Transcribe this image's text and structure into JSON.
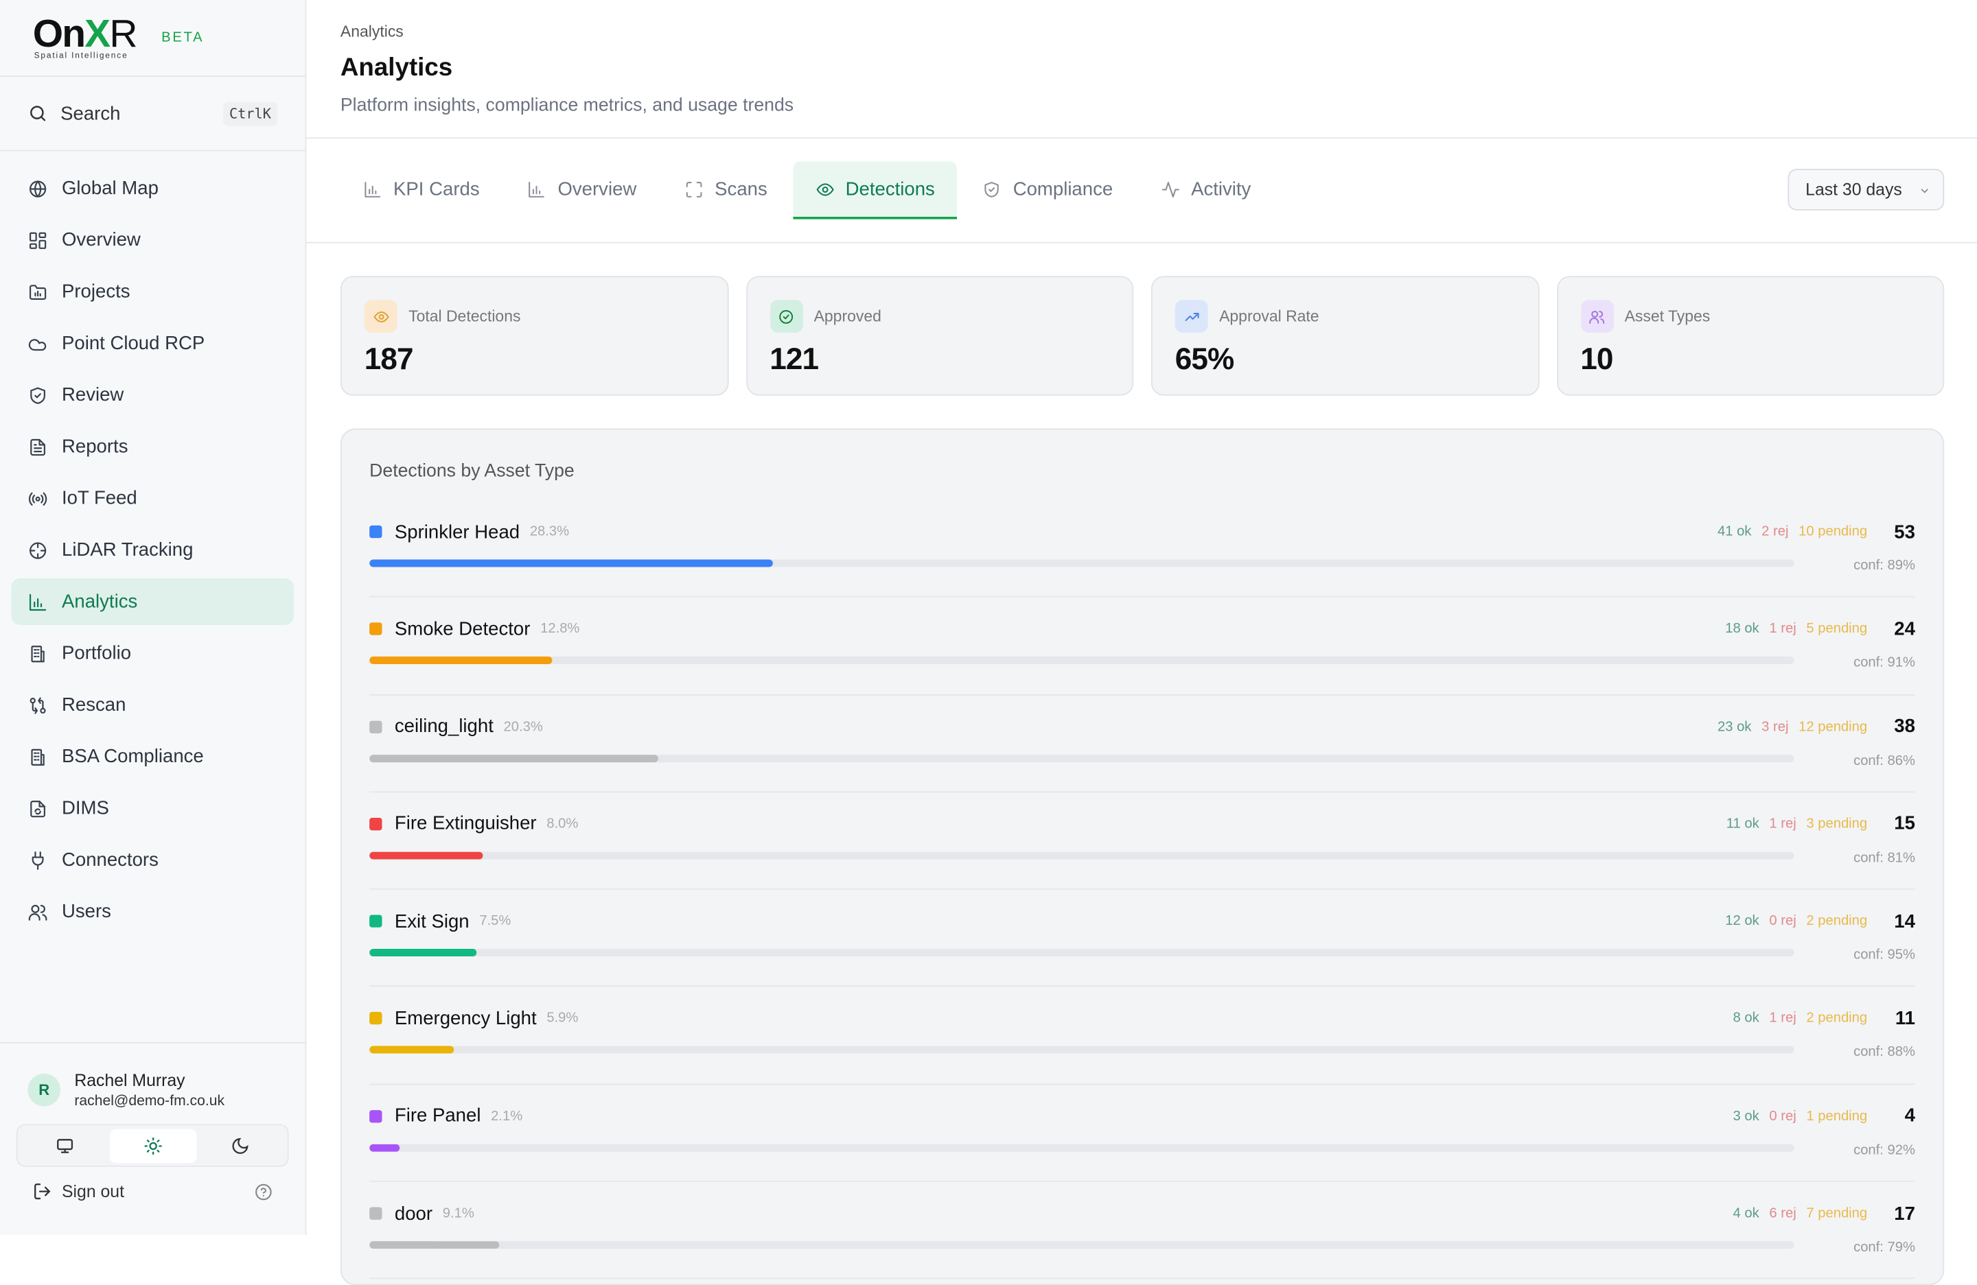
{
  "brand": {
    "logo_main": "On",
    "logo_x": "X",
    "logo_r": "R",
    "logo_sub": "Spatial Intelligence",
    "beta": "BETA"
  },
  "search": {
    "label": "Search",
    "shortcut": "CtrlK"
  },
  "sidebar": {
    "items": [
      {
        "label": "Global Map",
        "icon": "globe-icon",
        "name": "sidebar-item-global-map",
        "active": false
      },
      {
        "label": "Overview",
        "icon": "dashboard-icon",
        "name": "sidebar-item-overview",
        "active": false
      },
      {
        "label": "Projects",
        "icon": "folder-chart-icon",
        "name": "sidebar-item-projects",
        "active": false
      },
      {
        "label": "Point Cloud RCP",
        "icon": "cloud-icon",
        "name": "sidebar-item-point-cloud",
        "active": false
      },
      {
        "label": "Review",
        "icon": "shield-check-icon",
        "name": "sidebar-item-review",
        "active": false
      },
      {
        "label": "Reports",
        "icon": "file-text-icon",
        "name": "sidebar-item-reports",
        "active": false
      },
      {
        "label": "IoT Feed",
        "icon": "radio-icon",
        "name": "sidebar-item-iot-feed",
        "active": false
      },
      {
        "label": "LiDAR Tracking",
        "icon": "crosshair-icon",
        "name": "sidebar-item-lidar",
        "active": false
      },
      {
        "label": "Analytics",
        "icon": "bar-chart-icon",
        "name": "sidebar-item-analytics",
        "active": true
      },
      {
        "label": "Portfolio",
        "icon": "building-icon",
        "name": "sidebar-item-portfolio",
        "active": false
      },
      {
        "label": "Rescan",
        "icon": "git-compare-icon",
        "name": "sidebar-item-rescan",
        "active": false
      },
      {
        "label": "BSA Compliance",
        "icon": "building-icon",
        "name": "sidebar-item-bsa",
        "active": false
      },
      {
        "label": "DIMS",
        "icon": "file-sync-icon",
        "name": "sidebar-item-dims",
        "active": false
      },
      {
        "label": "Connectors",
        "icon": "plug-icon",
        "name": "sidebar-item-connectors",
        "active": false
      },
      {
        "label": "Users",
        "icon": "users-icon",
        "name": "sidebar-item-users",
        "active": false
      }
    ]
  },
  "user": {
    "initial": "R",
    "name": "Rachel Murray",
    "email": "rachel@demo-fm.co.uk"
  },
  "theme": {
    "selected": "light"
  },
  "signout": {
    "label": "Sign out"
  },
  "header": {
    "breadcrumb": "Analytics",
    "title": "Analytics",
    "subtitle": "Platform insights, compliance metrics, and usage trends"
  },
  "tabs": [
    {
      "label": "KPI Cards",
      "icon": "bar-chart-icon",
      "active": false
    },
    {
      "label": "Overview",
      "icon": "bar-chart-icon",
      "active": false
    },
    {
      "label": "Scans",
      "icon": "scan-icon",
      "active": false
    },
    {
      "label": "Detections",
      "icon": "eye-icon",
      "active": true
    },
    {
      "label": "Compliance",
      "icon": "shield-check-icon",
      "active": false
    },
    {
      "label": "Activity",
      "icon": "activity-icon",
      "active": false
    }
  ],
  "range": {
    "value": "Last 30 days"
  },
  "kpis": [
    {
      "label": "Total Detections",
      "value": "187",
      "icon": "eye-icon",
      "icon_bg": "#fbe8cf",
      "icon_color": "#e0a030"
    },
    {
      "label": "Approved",
      "value": "121",
      "icon": "check-circle-icon",
      "icon_bg": "#d3efe2",
      "icon_color": "#15803d"
    },
    {
      "label": "Approval Rate",
      "value": "65%",
      "icon": "trending-up-icon",
      "icon_bg": "#dbe6fb",
      "icon_color": "#4a7fe0"
    },
    {
      "label": "Asset Types",
      "value": "10",
      "icon": "users-icon",
      "icon_bg": "#ece1fb",
      "icon_color": "#a475e0"
    }
  ],
  "detections_panel": {
    "title": "Detections by Asset Type",
    "rows": [
      {
        "name": "Sprinkler Head",
        "pct": "28.3%",
        "ok": "41 ok",
        "rej": "2 rej",
        "pending": "10 pending",
        "count": "53",
        "conf": "conf: 89%",
        "color": "#3b82f6",
        "share": 0.283
      },
      {
        "name": "Smoke Detector",
        "pct": "12.8%",
        "ok": "18 ok",
        "rej": "1 rej",
        "pending": "5 pending",
        "count": "24",
        "conf": "conf: 91%",
        "color": "#f59e0b",
        "share": 0.128
      },
      {
        "name": "ceiling_light",
        "pct": "20.3%",
        "ok": "23 ok",
        "rej": "3 rej",
        "pending": "12 pending",
        "count": "38",
        "conf": "conf: 86%",
        "color": "#bdbdbd",
        "share": 0.203
      },
      {
        "name": "Fire Extinguisher",
        "pct": "8.0%",
        "ok": "11 ok",
        "rej": "1 rej",
        "pending": "3 pending",
        "count": "15",
        "conf": "conf: 81%",
        "color": "#ef4444",
        "share": 0.08
      },
      {
        "name": "Exit Sign",
        "pct": "7.5%",
        "ok": "12 ok",
        "rej": "0 rej",
        "pending": "2 pending",
        "count": "14",
        "conf": "conf: 95%",
        "color": "#10b981",
        "share": 0.075
      },
      {
        "name": "Emergency Light",
        "pct": "5.9%",
        "ok": "8 ok",
        "rej": "1 rej",
        "pending": "2 pending",
        "count": "11",
        "conf": "conf: 88%",
        "color": "#eab308",
        "share": 0.059
      },
      {
        "name": "Fire Panel",
        "pct": "2.1%",
        "ok": "3 ok",
        "rej": "0 rej",
        "pending": "1 pending",
        "count": "4",
        "conf": "conf: 92%",
        "color": "#a855f7",
        "share": 0.021
      },
      {
        "name": "door",
        "pct": "9.1%",
        "ok": "4 ok",
        "rej": "6 rej",
        "pending": "7 pending",
        "count": "17",
        "conf": "conf: 79%",
        "color": "#bdbdbd",
        "share": 0.091
      }
    ]
  }
}
